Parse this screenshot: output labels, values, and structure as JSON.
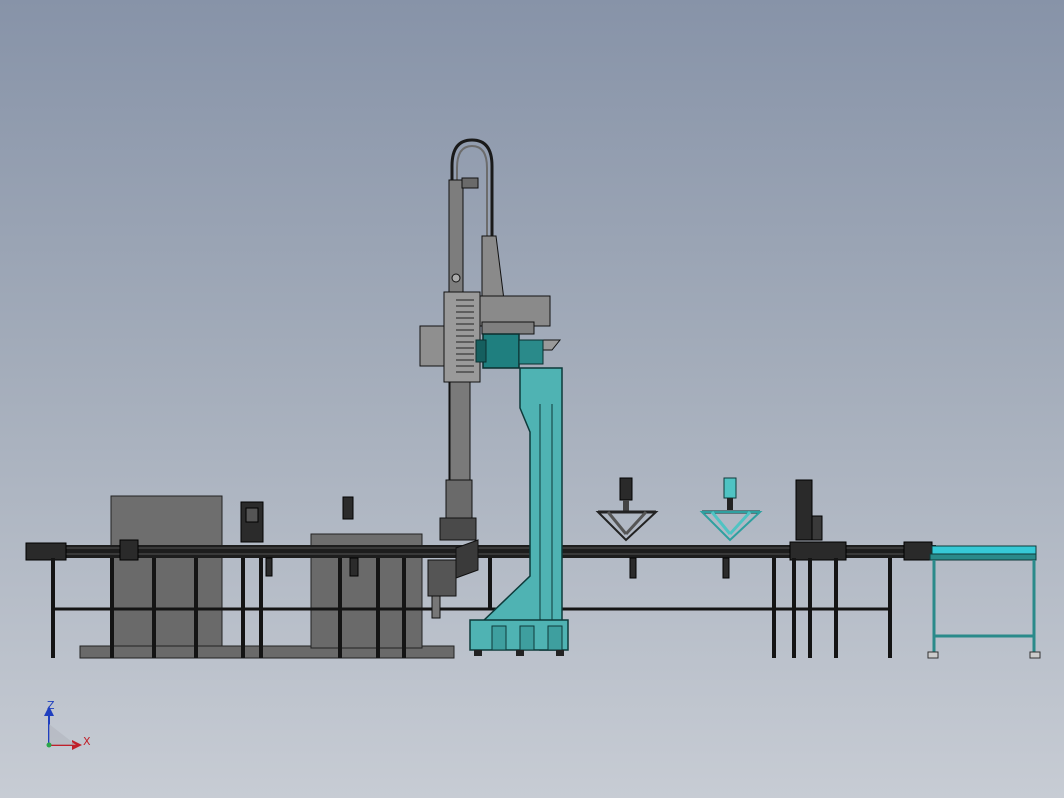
{
  "viewport": {
    "background_top": "#8793a8",
    "background_bottom": "#c7ccd4"
  },
  "colors": {
    "frame_line": "#111111",
    "housing_gray": "#6e6e6e",
    "robot_gray": "#8a8a8a",
    "accent_teal": "#4fb3b3",
    "motor_teal": "#1f7f7f",
    "outfeed_cyan": "#36c9d6"
  },
  "triad": {
    "z_label": "Z",
    "x_label": "X",
    "z_color": "#1f3fbf",
    "x_color": "#c0202a",
    "origin_color": "#2aa64a"
  }
}
